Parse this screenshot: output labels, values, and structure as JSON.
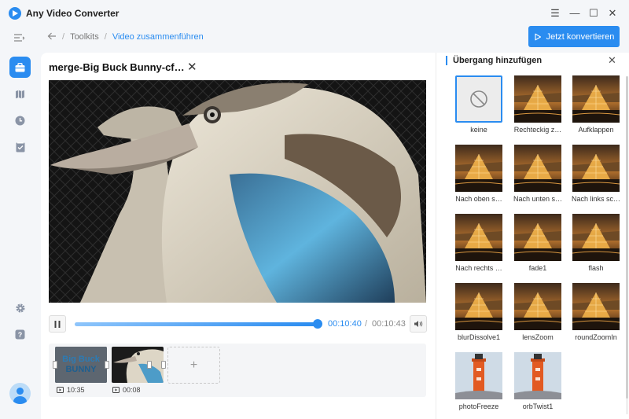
{
  "app": {
    "title": "Any Video Converter"
  },
  "window_controls": {
    "menu": "☰",
    "minimize": "—",
    "maximize": "☐",
    "close": "✕"
  },
  "breadcrumb": {
    "root": "Toolkits",
    "current": "Video zusammenführen",
    "separator": "/"
  },
  "toolbar": {
    "convert_label": "Jetzt konvertieren"
  },
  "editor": {
    "title": "merge-Big Buck Bunny-cf…",
    "close": "✕",
    "playback": {
      "current_time": "00:10:40",
      "separator": "/",
      "total_time": "00:10:43",
      "progress": 0.99
    },
    "clips": [
      {
        "thumb_text_line1": "Big Buck",
        "thumb_text_line2": "BUNNY",
        "duration": "10:35"
      },
      {
        "duration": "00:08"
      }
    ],
    "add_clip": "+"
  },
  "transitions": {
    "title": "Übergang hinzufügen",
    "close": "✕",
    "items": [
      {
        "label": "keine",
        "kind": "none"
      },
      {
        "label": "Rechteckig z…",
        "kind": "louvre"
      },
      {
        "label": "Aufklappen",
        "kind": "louvre"
      },
      {
        "label": "Nach oben s…",
        "kind": "louvre"
      },
      {
        "label": "Nach unten s…",
        "kind": "louvre"
      },
      {
        "label": "Nach links sc…",
        "kind": "louvre"
      },
      {
        "label": "Nach rechts …",
        "kind": "louvre"
      },
      {
        "label": "fade1",
        "kind": "louvre"
      },
      {
        "label": "flash",
        "kind": "louvre"
      },
      {
        "label": "blurDissolve1",
        "kind": "louvre"
      },
      {
        "label": "lensZoom",
        "kind": "louvre"
      },
      {
        "label": "roundZoomIn",
        "kind": "louvre"
      },
      {
        "label": "photoFreeze",
        "kind": "lighthouse"
      },
      {
        "label": "orbTwist1",
        "kind": "lighthouse"
      }
    ]
  },
  "colors": {
    "accent": "#2a8cf0",
    "sidebar_bg": "#f4f6f9",
    "panel_bg": "#ffffff"
  },
  "sidebar": {
    "icons": [
      "toolbox-icon",
      "map-icon",
      "clock-icon",
      "task-check-icon",
      "settings-icon",
      "help-icon",
      "user-avatar"
    ]
  }
}
